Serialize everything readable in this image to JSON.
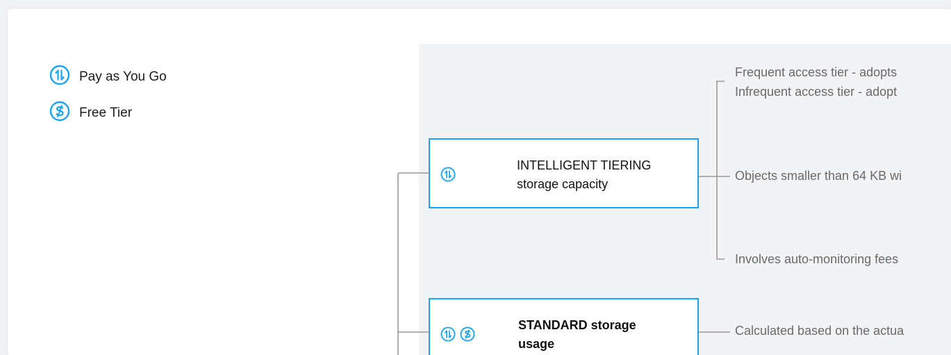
{
  "legend": {
    "pay_as_you_go": "Pay as You Go",
    "free_tier": "Free Tier"
  },
  "nodes": {
    "intelligent_tiering": {
      "line1": "INTELLIGENT TIERING",
      "line2": "storage capacity"
    },
    "standard": {
      "line1": "STANDARD storage",
      "line2": "usage"
    }
  },
  "descriptions": {
    "frequent": "Frequent access tier - adopts",
    "infrequent": "Infrequent access tier - adopt",
    "small_objects": "Objects smaller than 64 KB wi",
    "monitoring": "Involves auto-monitoring fees",
    "standard_calc": "Calculated based on the actua"
  },
  "colors": {
    "accent": "#1aa3ee",
    "line": "#9a9a9a",
    "panel": "#f2f3f5"
  },
  "icons": {
    "pay_as_you_go": "pay-as-you-go-icon",
    "free_tier": "free-tier-icon"
  }
}
